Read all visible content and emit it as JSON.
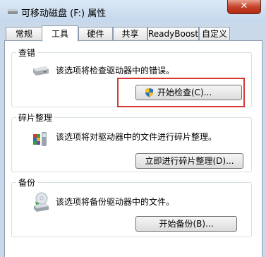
{
  "window": {
    "title": "可移动磁盘 (F:) 属性",
    "close_label": "✕"
  },
  "tabs": [
    "常规",
    "工具",
    "硬件",
    "共享",
    "ReadyBoost",
    "自定义"
  ],
  "active_tab": "工具",
  "groups": {
    "error_check": {
      "title": "查错",
      "desc": "该选项将检查驱动器中的错误。",
      "button": "开始检查(C)..."
    },
    "defrag": {
      "title": "碎片整理",
      "desc": "该选项将对驱动器中的文件进行碎片整理。",
      "button": "立即进行碎片整理(D)..."
    },
    "backup": {
      "title": "备份",
      "desc": "该选项将备份驱动器中的文件。",
      "button": "开始备份(B)..."
    }
  },
  "colors": {
    "highlight": "#d33a36",
    "shield_blue": "#2f6fc1",
    "shield_yellow": "#f2c21b"
  }
}
